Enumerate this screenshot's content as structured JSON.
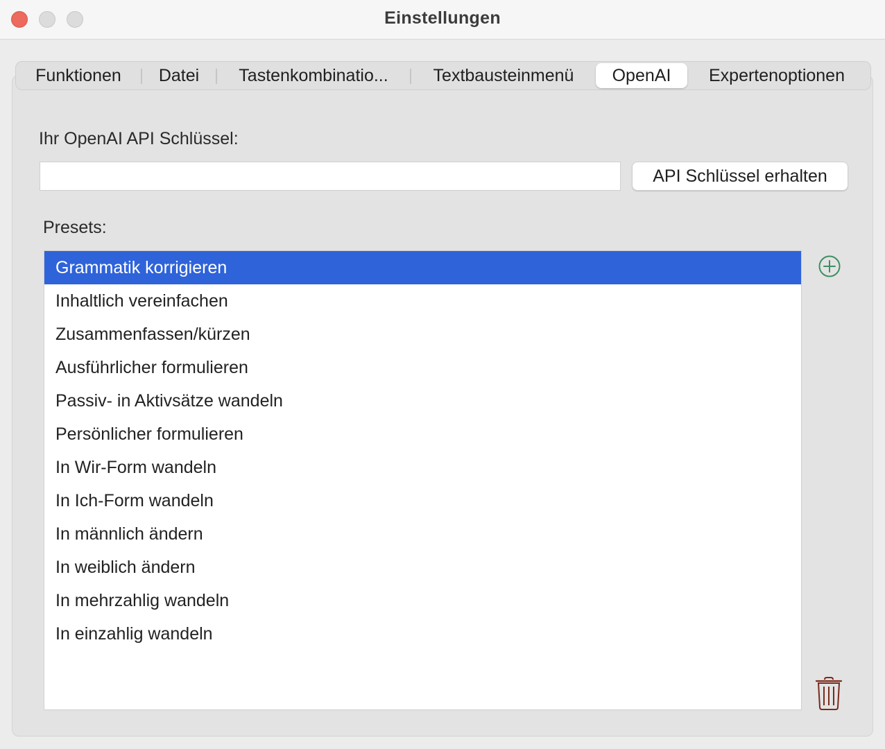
{
  "window": {
    "title": "Einstellungen"
  },
  "tabs": [
    {
      "label": "Funktionen",
      "active": false
    },
    {
      "label": "Datei",
      "active": false
    },
    {
      "label": "Tastenkombinatio...",
      "active": false
    },
    {
      "label": "Textbausteinmenü",
      "active": false
    },
    {
      "label": "OpenAI",
      "active": true
    },
    {
      "label": "Expertenoptionen",
      "active": false
    }
  ],
  "openai": {
    "api_key_label": "Ihr OpenAI API Schlüssel:",
    "api_key_value": "",
    "get_key_button": "API Schlüssel erhalten",
    "presets_label": "Presets:",
    "presets": [
      {
        "label": "Grammatik korrigieren",
        "selected": true
      },
      {
        "label": "Inhaltlich vereinfachen",
        "selected": false
      },
      {
        "label": "Zusammenfassen/kürzen",
        "selected": false
      },
      {
        "label": "Ausführlicher formulieren",
        "selected": false
      },
      {
        "label": "Passiv- in Aktivsätze wandeln",
        "selected": false
      },
      {
        "label": "Persönlicher formulieren",
        "selected": false
      },
      {
        "label": "In Wir-Form wandeln",
        "selected": false
      },
      {
        "label": "In Ich-Form wandeln",
        "selected": false
      },
      {
        "label": "In männlich ändern",
        "selected": false
      },
      {
        "label": "In weiblich ändern",
        "selected": false
      },
      {
        "label": "In mehrzahlig wandeln",
        "selected": false
      },
      {
        "label": "In einzahlig wandeln",
        "selected": false
      }
    ]
  },
  "icons": {
    "add": "add-circle-icon",
    "delete": "trash-icon"
  },
  "colors": {
    "selection": "#2e63da",
    "add_icon": "#3e8f63",
    "trash_icon": "#7a2a1c",
    "close_button": "#ec6a5e"
  }
}
